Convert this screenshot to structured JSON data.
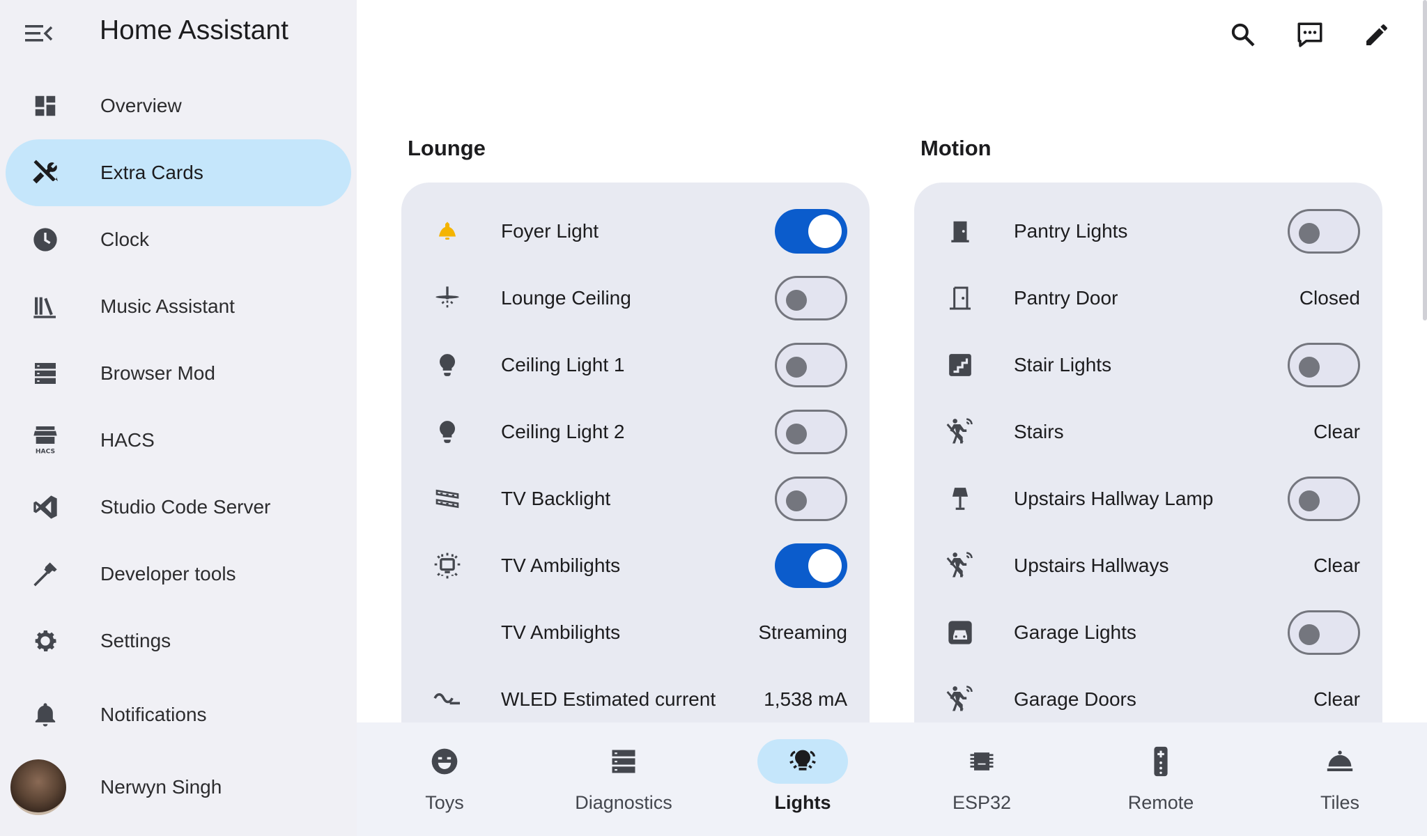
{
  "app": {
    "title": "Home Assistant"
  },
  "sidebar": {
    "items": [
      {
        "label": "Overview",
        "icon": "dashboard-icon",
        "active": false
      },
      {
        "label": "Extra Cards",
        "icon": "tools-icon",
        "active": true
      },
      {
        "label": "Clock",
        "icon": "clock-icon",
        "active": false
      },
      {
        "label": "Music Assistant",
        "icon": "music-library-icon",
        "active": false
      },
      {
        "label": "Browser Mod",
        "icon": "server-icon",
        "active": false
      },
      {
        "label": "HACS",
        "icon": "hacs-store-icon",
        "active": false,
        "icon_text": "HACS"
      },
      {
        "label": "Studio Code Server",
        "icon": "vscode-icon",
        "active": false
      },
      {
        "label": "Developer tools",
        "icon": "hammer-icon",
        "active": false
      },
      {
        "label": "Settings",
        "icon": "gear-icon",
        "active": false
      },
      {
        "label": "Notifications",
        "icon": "bell-icon",
        "active": false
      }
    ],
    "user": {
      "name": "Nerwyn Singh"
    }
  },
  "toolbar": {
    "search": "search-icon",
    "assist": "assist-icon",
    "edit": "pencil-icon"
  },
  "sections": {
    "lounge": {
      "title": "Lounge",
      "rows": [
        {
          "label": "Foyer Light",
          "icon": "bell-light-icon",
          "type": "toggle",
          "on": true
        },
        {
          "label": "Lounge Ceiling",
          "icon": "ceiling-fan-icon",
          "type": "toggle",
          "on": false
        },
        {
          "label": "Ceiling Light 1",
          "icon": "lightbulb-icon",
          "type": "toggle",
          "on": false
        },
        {
          "label": "Ceiling Light 2",
          "icon": "lightbulb-icon",
          "type": "toggle",
          "on": false
        },
        {
          "label": "TV Backlight",
          "icon": "led-strip-icon",
          "type": "toggle",
          "on": false
        },
        {
          "label": "TV Ambilights",
          "icon": "tv-ambilight-icon",
          "type": "toggle",
          "on": true
        },
        {
          "label": "TV Ambilights",
          "icon": "",
          "type": "state",
          "state": "Streaming"
        },
        {
          "label": "WLED Estimated current",
          "icon": "current-ac-icon",
          "type": "state",
          "state": "1,538 mA"
        }
      ]
    },
    "motion": {
      "title": "Motion",
      "rows": [
        {
          "label": "Pantry Lights",
          "icon": "door-closed-icon",
          "type": "toggle",
          "on": false
        },
        {
          "label": "Pantry Door",
          "icon": "door-icon",
          "type": "state",
          "state": "Closed"
        },
        {
          "label": "Stair Lights",
          "icon": "stairs-icon",
          "type": "toggle",
          "on": false
        },
        {
          "label": "Stairs",
          "icon": "motion-sensor-icon",
          "type": "state",
          "state": "Clear"
        },
        {
          "label": "Upstairs Hallway Lamp",
          "icon": "lamp-icon",
          "type": "toggle",
          "on": false
        },
        {
          "label": "Upstairs Hallways",
          "icon": "motion-sensor-icon",
          "type": "state",
          "state": "Clear"
        },
        {
          "label": "Garage Lights",
          "icon": "car-garage-icon",
          "type": "toggle",
          "on": false
        },
        {
          "label": "Garage Doors",
          "icon": "motion-sensor-icon",
          "type": "state",
          "state": "Clear"
        }
      ]
    }
  },
  "bottom_nav": {
    "tabs": [
      {
        "label": "Toys",
        "icon": "emoticon-icon",
        "active": false
      },
      {
        "label": "Diagnostics",
        "icon": "server-icon",
        "active": false
      },
      {
        "label": "Lights",
        "icon": "lights-icon",
        "active": true
      },
      {
        "label": "ESP32",
        "icon": "chip-icon",
        "active": false
      },
      {
        "label": "Remote",
        "icon": "remote-icon",
        "active": false
      },
      {
        "label": "Tiles",
        "icon": "room-service-icon",
        "active": false
      }
    ]
  },
  "colors": {
    "accent": "#0b5ccc",
    "active_nav_bg": "#c5e6fb",
    "sidebar_bg": "#f0f0f5",
    "card_bg": "#e8eaf2",
    "foyer_icon": "#f4b400"
  }
}
